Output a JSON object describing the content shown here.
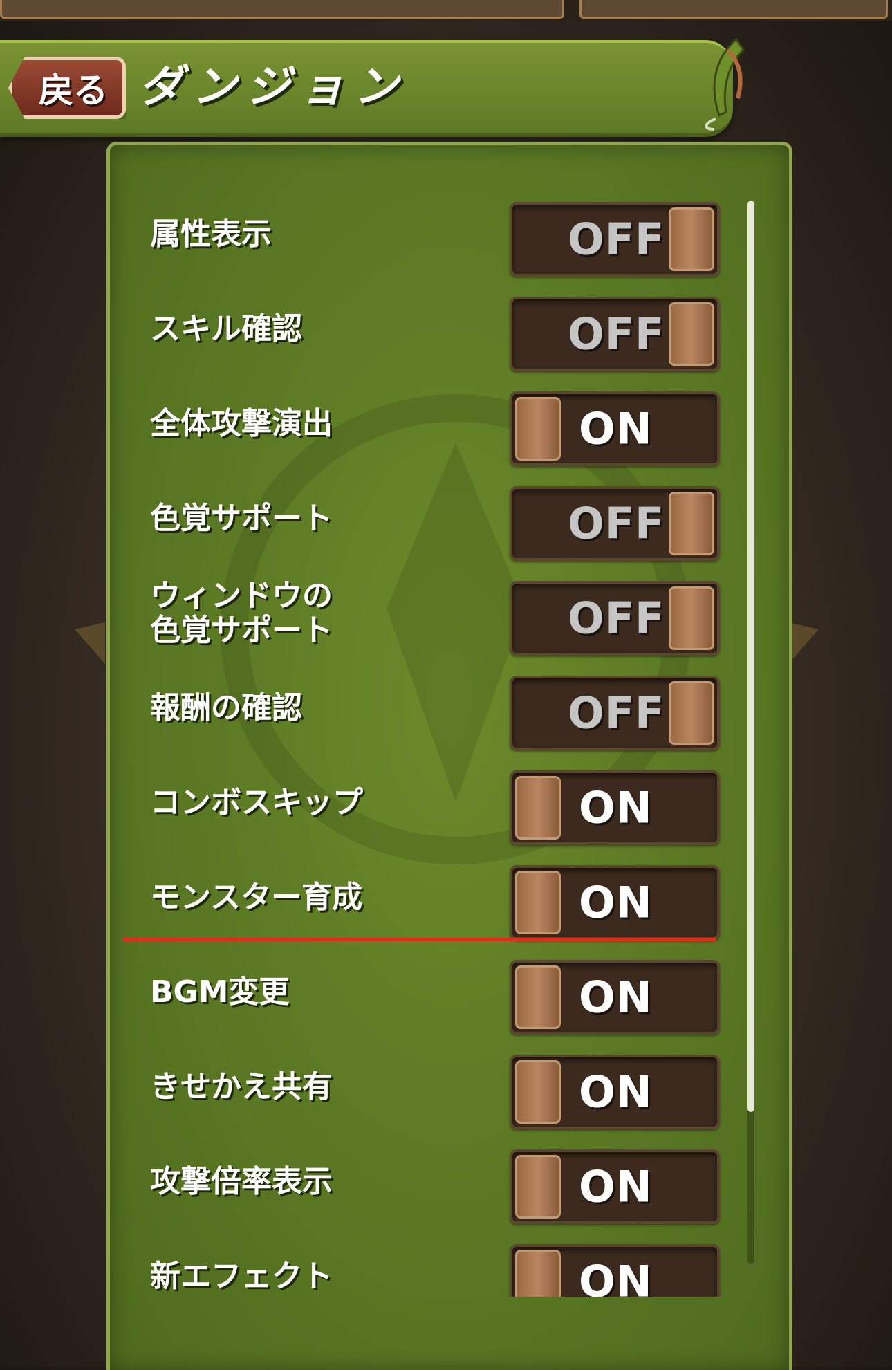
{
  "header": {
    "back_label": "戻る",
    "title": "ダンジョン"
  },
  "settings": [
    {
      "label": "属性表示",
      "state": "off",
      "value": "OFF"
    },
    {
      "label": "スキル確認",
      "state": "off",
      "value": "OFF"
    },
    {
      "label": "全体攻撃演出",
      "state": "on",
      "value": "ON"
    },
    {
      "label": "色覚サポート",
      "state": "off",
      "value": "OFF"
    },
    {
      "label": "ウィンドウの\n色覚サポート",
      "state": "off",
      "value": "OFF"
    },
    {
      "label": "報酬の確認",
      "state": "off",
      "value": "OFF"
    },
    {
      "label": "コンボスキップ",
      "state": "on",
      "value": "ON"
    },
    {
      "label": "モンスター育成",
      "state": "on",
      "value": "ON"
    },
    {
      "label": "BGM変更",
      "state": "on",
      "value": "ON"
    },
    {
      "label": "きせかえ共有",
      "state": "on",
      "value": "ON"
    },
    {
      "label": "攻撃倍率表示",
      "state": "on",
      "value": "ON"
    },
    {
      "label": "新エフェクト",
      "state": "on",
      "value": "ON"
    }
  ],
  "colors": {
    "panel": "#5a7824",
    "header": "#6c8a2a",
    "back_button": "#8a3b28",
    "toggle_track": "#3b2a1d",
    "divider": "#d8311c"
  },
  "icons": [
    "leaf-dragon-icon"
  ]
}
